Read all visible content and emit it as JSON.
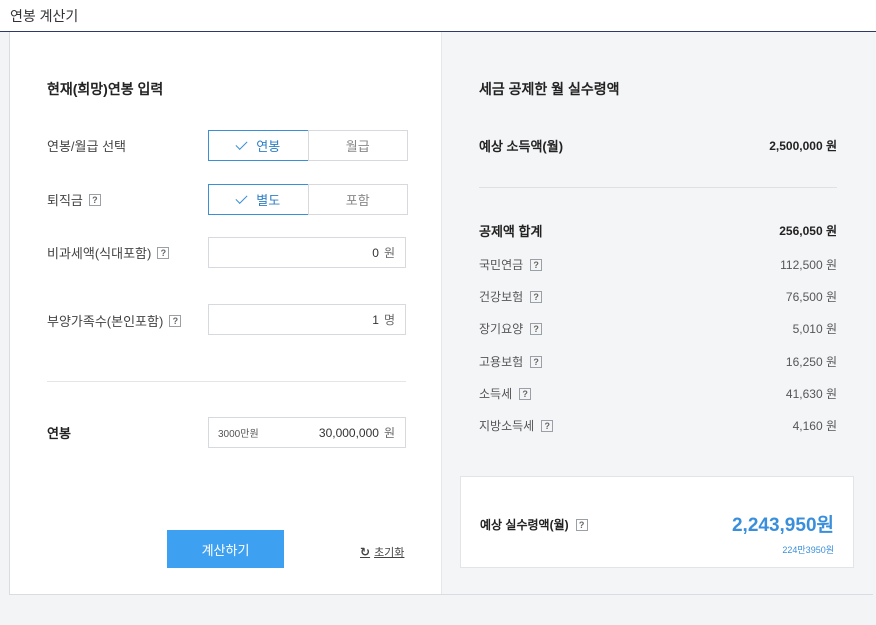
{
  "window": {
    "title": "연봉 계산기"
  },
  "input": {
    "section_title": "현재(희망)연봉 입력",
    "salary_type": {
      "label": "연봉/월급 선택",
      "options": [
        "연봉",
        "월급"
      ],
      "selected": "연봉"
    },
    "severance": {
      "label": "퇴직금",
      "options": [
        "별도",
        "포함"
      ],
      "selected": "별도"
    },
    "nontaxable": {
      "label": "비과세액(식대포함)",
      "value": "0",
      "unit": "원"
    },
    "dependents": {
      "label": "부양가족수(본인포함)",
      "value": "1",
      "unit": "명"
    },
    "annual": {
      "label": "연봉",
      "hint": "3000만원",
      "value": "30,000,000",
      "unit": "원"
    },
    "calc_button": "계산하기",
    "reset_button": "초기화"
  },
  "result": {
    "section_title": "세금 공제한 월 실수령액",
    "expected_income": {
      "label": "예상 소득액(월)",
      "value": "2,500,000 원"
    },
    "deduction_total": {
      "label": "공제액 합계",
      "value": "256,050 원"
    },
    "deductions": [
      {
        "label": "국민연금",
        "value": "112,500 원"
      },
      {
        "label": "건강보험",
        "value": "76,500 원"
      },
      {
        "label": "장기요양",
        "value": "5,010 원"
      },
      {
        "label": "고용보험",
        "value": "16,250 원"
      },
      {
        "label": "소득세",
        "value": "41,630 원"
      },
      {
        "label": "지방소득세",
        "value": "4,160 원"
      }
    ],
    "net": {
      "label": "예상 실수령액(월)",
      "value": "2,243,950원",
      "sub": "224만3950원"
    }
  },
  "icons": {
    "help": "help-question-icon",
    "check": "check-icon",
    "reset": "refresh-icon"
  },
  "colors": {
    "accent": "#3ea0f0",
    "accent_text": "#3a8fdc",
    "title_border": "#2d3a66"
  }
}
